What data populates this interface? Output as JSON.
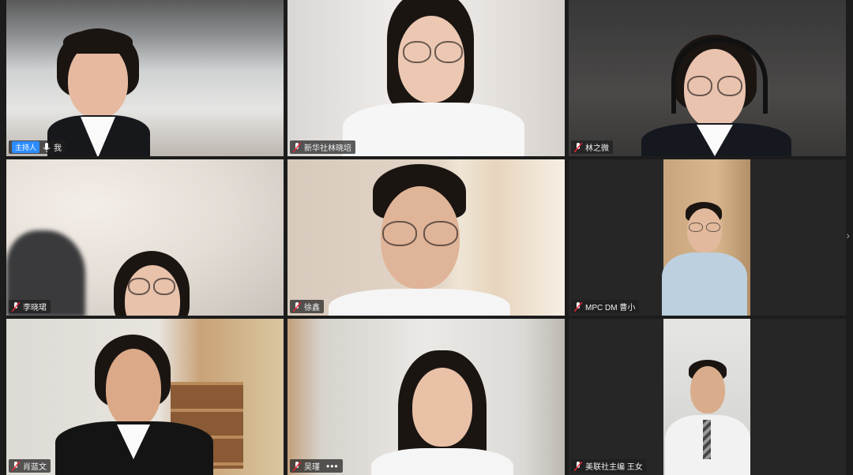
{
  "tiles": [
    {
      "name": "我",
      "host_badge": "主持人"
    },
    {
      "name": "新华社林晓培"
    },
    {
      "name": "林之微"
    },
    {
      "name": "李晓珺"
    },
    {
      "name": "徐鑫"
    },
    {
      "name": "MPC DM 曹小"
    },
    {
      "name": "肖蓝文"
    },
    {
      "name": "吴瑾",
      "more": "•••"
    },
    {
      "name": "美联社主编 王女"
    }
  ],
  "nav": {
    "next_icon": "chevron-right-icon",
    "glyph": "›"
  }
}
